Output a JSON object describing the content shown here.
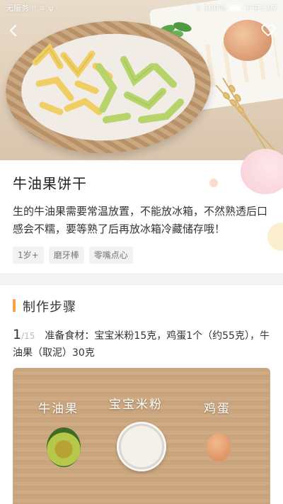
{
  "statusbar": {
    "carrier": "无服务",
    "battery": "100%",
    "time": "下午1:07"
  },
  "icons": {
    "back": "chevron-left-icon",
    "favorite": "heart-outline-icon"
  },
  "recipe": {
    "title": "牛油果饼干",
    "description": "生的牛油果需要常温放置，不能放冰箱，不然熟透后口感会不糯，要等熟了后再放冰箱冷藏储存哦！",
    "tags": [
      "1岁+",
      "磨牙棒",
      "零嘴点心"
    ]
  },
  "steps_section": {
    "title": "制作步骤",
    "current_step": "1",
    "total_steps": "/15",
    "step_text": "准备食材：宝宝米粉15克，鸡蛋1个（约55克），牛油果（取泥）30克",
    "image_labels": [
      "牛油果",
      "宝宝米粉",
      "鸡蛋"
    ]
  },
  "colors": {
    "accent": "#f7a24a",
    "tag_bg": "#f2f2f2",
    "divider_bg": "#f5f5f5"
  }
}
